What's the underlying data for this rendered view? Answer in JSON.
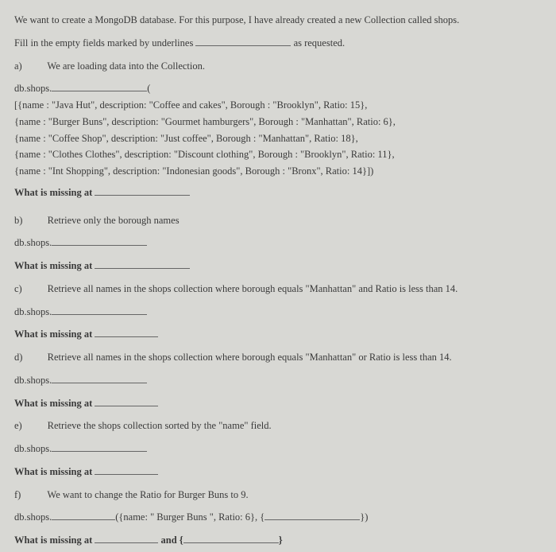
{
  "intro": "We want to create a MongoDB database. For this purpose, I have already created a new Collection called shops.",
  "fill_label": "Fill in the empty fields marked by underlines",
  "as_requested": "as requested.",
  "parts": {
    "a": {
      "label": "a)",
      "task": "We are loading data into the Collection.",
      "pre": "db.shops.",
      "post_open": "(",
      "code_lines": [
        "[{name : \"Java Hut\", description: \"Coffee and cakes\", Borough : \"Brooklyn\", Ratio: 15},",
        "{name : \"Burger Buns\", description: \"Gourmet hamburgers\", Borough : \"Manhattan\", Ratio: 6},",
        "{name : \"Coffee Shop\", description: \"Just coffee\", Borough : \"Manhattan\", Ratio: 18},",
        "{name : \"Clothes Clothes\", description: \"Discount clothing\", Borough : \"Brooklyn\", Ratio: 11},",
        "{name : \"Int Shopping\", description: \"Indonesian goods\", Borough : \"Bronx\", Ratio: 14}])"
      ]
    },
    "b": {
      "label": "b)",
      "task": "Retrieve only the borough names",
      "pre": "db.shops."
    },
    "c": {
      "label": "c)",
      "task": "Retrieve all names in the shops collection where borough equals \"Manhattan\" and Ratio is less than 14.",
      "pre": "db.shops."
    },
    "d": {
      "label": "d)",
      "task": "Retrieve all names in the shops collection where borough equals \"Manhattan\" or Ratio is less than 14.",
      "pre": "db.shops."
    },
    "e": {
      "label": "e)",
      "task": "Retrieve the shops collection sorted by the \"name\" field.",
      "pre": "db.shops."
    },
    "f": {
      "label": "f)",
      "task": "We want to change the Ratio for Burger Buns to 9.",
      "pre": "db.shops.",
      "mid": "({name: \" Burger Buns \", Ratio: 6}, {",
      "mid_close": "})",
      "and": "and {"
    }
  },
  "missing": "What is missing at"
}
